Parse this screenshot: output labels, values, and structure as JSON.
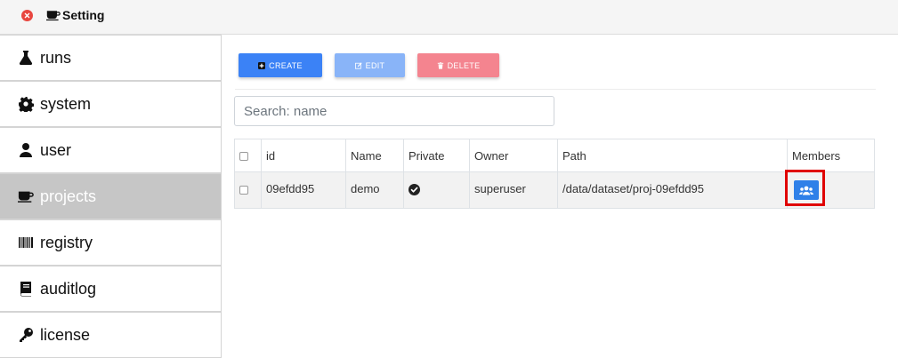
{
  "header": {
    "title": "Setting"
  },
  "sidebar": {
    "items": [
      {
        "label": "runs",
        "icon": "flask-icon"
      },
      {
        "label": "system",
        "icon": "gear-icon"
      },
      {
        "label": "user",
        "icon": "user-icon"
      },
      {
        "label": "projects",
        "icon": "coffee-cup-icon",
        "active": true
      },
      {
        "label": "registry",
        "icon": "barcode-icon"
      },
      {
        "label": "auditlog",
        "icon": "book-icon"
      },
      {
        "label": "license",
        "icon": "key-icon"
      }
    ]
  },
  "toolbar": {
    "create_label": "CREATE",
    "edit_label": "EDIT",
    "delete_label": "DELETE"
  },
  "search": {
    "placeholder": "Search: name",
    "value": ""
  },
  "table": {
    "headers": [
      "id",
      "Name",
      "Private",
      "Owner",
      "Path",
      "Members"
    ],
    "rows": [
      {
        "id": "09efdd95",
        "name": "demo",
        "private": true,
        "owner": "superuser",
        "path": "/data/dataset/proj-09efdd95"
      }
    ]
  },
  "colors": {
    "accent": "#3b82f6",
    "edit": "#89b4f8",
    "delete": "#f4848f",
    "highlight": "#e00000"
  }
}
